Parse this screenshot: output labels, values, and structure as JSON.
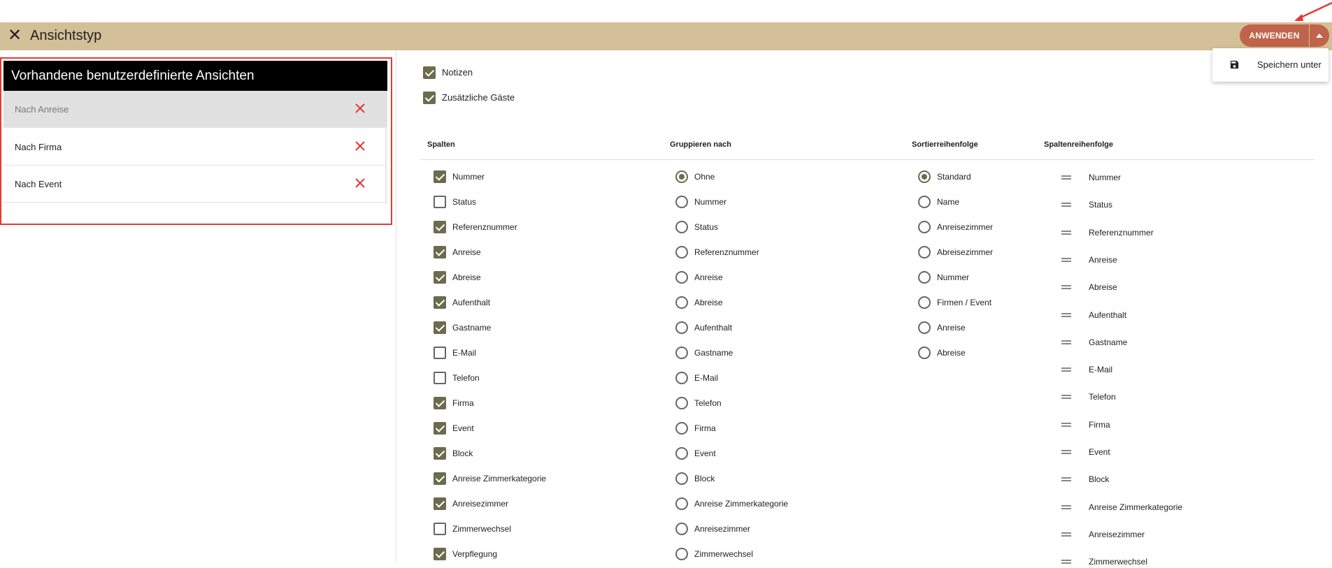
{
  "header": {
    "title": "Ansichtstyp",
    "apply_label": "ANWENDEN",
    "menu": {
      "save_as_label": "Speichern unter"
    }
  },
  "saved_views": {
    "title": "Vorhandene benutzerdefinierte Ansichten",
    "items": [
      {
        "label": "Nach Anreise",
        "selected": true
      },
      {
        "label": "Nach Firma",
        "selected": false
      },
      {
        "label": "Nach Event",
        "selected": false
      }
    ]
  },
  "options": {
    "notes": {
      "label": "Notizen",
      "checked": true
    },
    "extra_guests": {
      "label": "Zusätzliche Gäste",
      "checked": true
    }
  },
  "columns_section": {
    "headers": {
      "columns": "Spalten",
      "group_by": "Gruppieren nach",
      "sort_order": "Sortierreihenfolge",
      "column_order": "Spaltenreihenfolge"
    },
    "columns": [
      {
        "label": "Nummer",
        "checked": true
      },
      {
        "label": "Status",
        "checked": false
      },
      {
        "label": "Referenznummer",
        "checked": true
      },
      {
        "label": "Anreise",
        "checked": true
      },
      {
        "label": "Abreise",
        "checked": true
      },
      {
        "label": "Aufenthalt",
        "checked": true
      },
      {
        "label": "Gastname",
        "checked": true
      },
      {
        "label": "E-Mail",
        "checked": false
      },
      {
        "label": "Telefon",
        "checked": false
      },
      {
        "label": "Firma",
        "checked": true
      },
      {
        "label": "Event",
        "checked": true
      },
      {
        "label": "Block",
        "checked": true
      },
      {
        "label": "Anreise Zimmerkategorie",
        "checked": true
      },
      {
        "label": "Anreisezimmer",
        "checked": true
      },
      {
        "label": "Zimmerwechsel",
        "checked": false
      },
      {
        "label": "Verpflegung",
        "checked": true
      }
    ],
    "group_by": [
      {
        "label": "Ohne",
        "selected": true
      },
      {
        "label": "Nummer",
        "selected": false
      },
      {
        "label": "Status",
        "selected": false
      },
      {
        "label": "Referenznummer",
        "selected": false
      },
      {
        "label": "Anreise",
        "selected": false
      },
      {
        "label": "Abreise",
        "selected": false
      },
      {
        "label": "Aufenthalt",
        "selected": false
      },
      {
        "label": "Gastname",
        "selected": false
      },
      {
        "label": "E-Mail",
        "selected": false
      },
      {
        "label": "Telefon",
        "selected": false
      },
      {
        "label": "Firma",
        "selected": false
      },
      {
        "label": "Event",
        "selected": false
      },
      {
        "label": "Block",
        "selected": false
      },
      {
        "label": "Anreise Zimmerkategorie",
        "selected": false
      },
      {
        "label": "Anreisezimmer",
        "selected": false
      },
      {
        "label": "Zimmerwechsel",
        "selected": false
      }
    ],
    "sort_order": [
      {
        "label": "Standard",
        "selected": true
      },
      {
        "label": "Name",
        "selected": false
      },
      {
        "label": "Anreisezimmer",
        "selected": false
      },
      {
        "label": "Abreisezimmer",
        "selected": false
      },
      {
        "label": "Nummer",
        "selected": false
      },
      {
        "label": "Firmen / Event",
        "selected": false
      },
      {
        "label": "Anreise",
        "selected": false
      },
      {
        "label": "Abreise",
        "selected": false
      }
    ],
    "column_order": [
      "Nummer",
      "Status",
      "Referenznummer",
      "Anreise",
      "Abreise",
      "Aufenthalt",
      "Gastname",
      "E-Mail",
      "Telefon",
      "Firma",
      "Event",
      "Block",
      "Anreise Zimmerkategorie",
      "Anreisezimmer",
      "Zimmerwechsel"
    ]
  },
  "colors": {
    "header_bg": "#d3bf98",
    "accent": "#c0634b",
    "check": "#6b6b4e",
    "delete": "#e53935"
  }
}
